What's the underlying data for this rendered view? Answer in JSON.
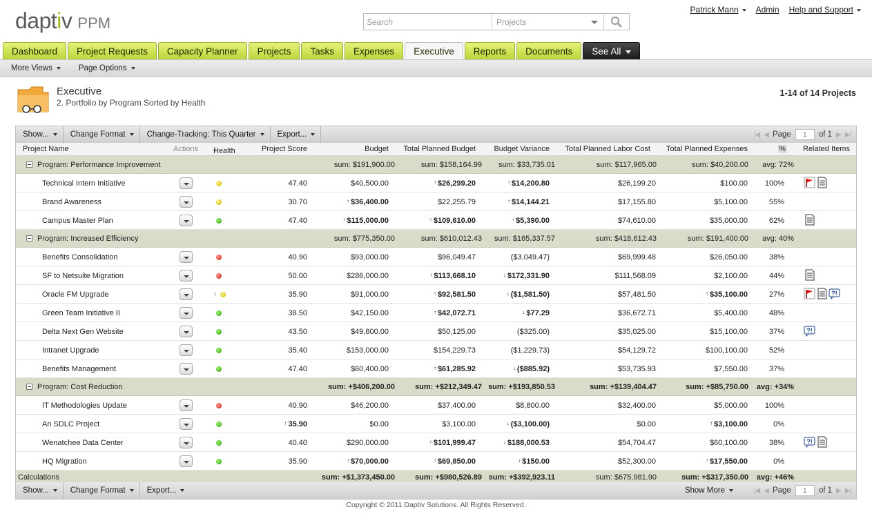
{
  "header": {
    "brand_left": "dapt",
    "brand_i": "i",
    "brand_right": "v",
    "product": "PPM",
    "search_placeholder": "Search",
    "search_scope": "Projects",
    "user": "Patrick Mann",
    "admin": "Admin",
    "help": "Help and Support"
  },
  "tabs": [
    "Dashboard",
    "Project Requests",
    "Capacity Planner",
    "Projects",
    "Tasks",
    "Expenses",
    "Executive",
    "Reports",
    "Documents"
  ],
  "see_all": "See All",
  "subnav": {
    "more_views": "More Views",
    "page_options": "Page Options"
  },
  "page": {
    "title": "Executive",
    "subtitle": "2. Portfolio by Program Sorted by Health",
    "count": "1-14 of 14 Projects"
  },
  "toolbar": {
    "show": "Show...",
    "change_format": "Change Format",
    "change_tracking": "Change-Tracking: This Quarter",
    "export": "Export...",
    "page_label": "Page",
    "page_value": "1",
    "of": "of 1",
    "show_more": "Show More"
  },
  "columns": {
    "name": "Project Name",
    "actions": "Actions",
    "health": "Health",
    "score": "Project Score",
    "budget": "Budget",
    "tpb": "Total Planned Budget",
    "variance": "Budget Variance",
    "labor": "Total Planned Labor Cost",
    "expenses": "Total Planned Expenses",
    "pct": "%",
    "related": "Related Items"
  },
  "groups": [
    {
      "label": "Program: Performance Improvement",
      "budget": "sum: $191,900.00",
      "tpb": "sum: $158,164.99",
      "variance": "sum: $33,735.01",
      "labor": "sum: $117,965.00",
      "expenses": "sum: $40,200.00",
      "pct": "avg: 72%",
      "bold": false,
      "projects": [
        {
          "name": "Technical Intern Initiative",
          "health": "yellow",
          "score": "47.40",
          "budget": "$40,500.00",
          "tpb": "$26,299.20",
          "variance": "$14,200.80",
          "labor": "$26,199.20",
          "expenses": "$100.00",
          "pct": "100%",
          "b_tpb": "up",
          "b_var": "up",
          "icons": [
            "flag",
            "doc"
          ]
        },
        {
          "name": "Brand Awareness",
          "health": "yellow",
          "score": "30.70",
          "budget": "$36,400.00",
          "tpb": "$22,255.79",
          "variance": "$14,144.21",
          "labor": "$17,155.80",
          "expenses": "$5,100.00",
          "pct": "55%",
          "b_budget": "up",
          "b_var": "up",
          "icons": []
        },
        {
          "name": "Campus Master Plan",
          "health": "green",
          "score": "47.40",
          "budget": "$115,000.00",
          "tpb": "$109,610.00",
          "variance": "$5,390.00",
          "labor": "$74,610.00",
          "expenses": "$35,000.00",
          "pct": "62%",
          "b_budget": "up",
          "b_tpb": "up",
          "b_var": "up",
          "icons": [
            "doc"
          ]
        }
      ]
    },
    {
      "label": "Program: Increased Efficiency",
      "budget": "sum: $775,350.00",
      "tpb": "sum: $610,012.43",
      "variance": "sum: $165,337.57",
      "labor": "sum: $418,612.43",
      "expenses": "sum: $191,400.00",
      "pct": "avg: 40%",
      "bold": false,
      "projects": [
        {
          "name": "Benefits Consolidation",
          "health": "red",
          "score": "40.90",
          "budget": "$93,000.00",
          "tpb": "$96,049.47",
          "variance": "($3,049.47)",
          "labor": "$69,999.48",
          "expenses": "$26,050.00",
          "pct": "38%",
          "icons": []
        },
        {
          "name": "SF to Netsuite Migration",
          "health": "red",
          "score": "50.00",
          "budget": "$286,000.00",
          "tpb": "$113,668.10",
          "variance": "$172,331.90",
          "labor": "$111,568.09",
          "expenses": "$2,100.00",
          "pct": "44%",
          "b_tpb": "up",
          "b_var": "down",
          "icons": [
            "doc"
          ]
        },
        {
          "name": "Oracle FM Upgrade",
          "health": "yellow",
          "health_trend": "down",
          "score": "35.90",
          "budget": "$91,000.00",
          "tpb": "$92,581.50",
          "variance": "($1,581.50)",
          "labor": "$57,481.50",
          "expenses": "$35,100.00",
          "pct": "27%",
          "b_tpb": "up",
          "b_var": "down",
          "b_exp": "up",
          "icons": [
            "flag",
            "doc",
            "question"
          ]
        },
        {
          "name": "Green Team Initiative II",
          "health": "green",
          "score": "38.50",
          "budget": "$42,150.00",
          "tpb": "$42,072.71",
          "variance": "$77.29",
          "labor": "$36,672.71",
          "expenses": "$5,400.00",
          "pct": "48%",
          "b_tpb": "up",
          "b_var": "down",
          "icons": []
        },
        {
          "name": "Delta Next Gen Website",
          "health": "green",
          "score": "43.50",
          "budget": "$49,800.00",
          "tpb": "$50,125.00",
          "variance": "($325.00)",
          "labor": "$35,025.00",
          "expenses": "$15,100.00",
          "pct": "37%",
          "icons": [
            "question"
          ]
        },
        {
          "name": "Intranet Upgrade",
          "health": "green",
          "score": "35.40",
          "budget": "$153,000.00",
          "tpb": "$154,229.73",
          "variance": "($1,229.73)",
          "labor": "$54,129.72",
          "expenses": "$100,100.00",
          "pct": "52%",
          "icons": []
        },
        {
          "name": "Benefits Management",
          "health": "green",
          "score": "47.40",
          "budget": "$60,400.00",
          "tpb": "$61,285.92",
          "variance": "($885.92)",
          "labor": "$53,735.93",
          "expenses": "$7,550.00",
          "pct": "37%",
          "b_tpb": "up",
          "b_var": "down",
          "icons": []
        }
      ]
    },
    {
      "label": "Program: Cost Reduction",
      "budget": "sum: +$406,200.00",
      "tpb": "sum: +$212,349.47",
      "variance": "sum: +$193,850.53",
      "labor": "sum: +$139,404.47",
      "expenses": "sum: +$85,750.00",
      "pct": "avg: +34%",
      "bold": true,
      "projects": [
        {
          "name": "IT Methodologies Update",
          "health": "red",
          "score": "40.90",
          "budget": "$46,200.00",
          "tpb": "$37,400.00",
          "variance": "$8,800.00",
          "labor": "$32,400.00",
          "expenses": "$5,000.00",
          "pct": "100%",
          "icons": []
        },
        {
          "name": "An SDLC Project",
          "health": "green",
          "score": "35.90",
          "budget": "$0.00",
          "tpb": "$3,100.00",
          "variance": "($3,100.00)",
          "labor": "$0.00",
          "expenses": "$3,100.00",
          "pct": "0%",
          "b_score": "up",
          "b_var": "down",
          "b_exp": "up",
          "icons": []
        },
        {
          "name": "Wenatchee Data Center",
          "health": "green",
          "score": "40.40",
          "budget": "$290,000.00",
          "tpb": "$101,999.47",
          "variance": "$188,000.53",
          "labor": "$54,704.47",
          "expenses": "$60,100.00",
          "pct": "38%",
          "b_tpb": "up",
          "b_var": "down",
          "icons": [
            "question",
            "doc"
          ]
        },
        {
          "name": "HQ Migration",
          "health": "green",
          "score": "35.90",
          "budget": "$70,000.00",
          "tpb": "$69,850.00",
          "variance": "$150.00",
          "labor": "$52,300.00",
          "expenses": "$17,550.00",
          "pct": "0%",
          "b_budget": "up",
          "b_tpb": "up",
          "b_var": "down",
          "b_exp": "up",
          "icons": []
        }
      ]
    }
  ],
  "calculations": {
    "label": "Calculations",
    "budget": "sum: +$1,373,450.00",
    "tpb": "sum: +$980,526.89",
    "variance": "sum: +$392,923.11",
    "labor": "sum: $675,981.90",
    "expenses": "sum: +$317,350.00",
    "pct": "avg: +46%"
  },
  "footer": "Copyright © 2011 Daptiv Solutions. All Rights Reserved.",
  "colors": {
    "tab_green": "#bcd43b",
    "group_row": "#d8dcc8",
    "logo_accent": "#9bbb1f"
  }
}
